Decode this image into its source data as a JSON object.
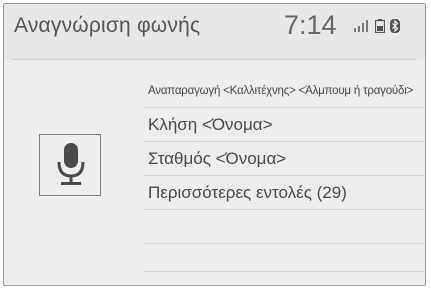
{
  "header": {
    "title": "Αναγνώριση φωνής",
    "time": "7:14",
    "status_icons": [
      "signal-bars-icon",
      "phone-battery-icon",
      "bluetooth-icon"
    ]
  },
  "mic_button": {
    "icon": "microphone-icon"
  },
  "commands": [
    {
      "label": "Αναπαραγωγή <Καλλιτέχνης> <Άλμπουμ ή τραγούδι>"
    },
    {
      "label": "Κλήση <Όνομα>"
    },
    {
      "label": "Σταθμός <Όνομα>"
    },
    {
      "label": "Περισσότερες εντολές (29)"
    }
  ],
  "colors": {
    "background": "#ededed",
    "text": "#4a4a4a",
    "separator": "#d4d4d4"
  }
}
